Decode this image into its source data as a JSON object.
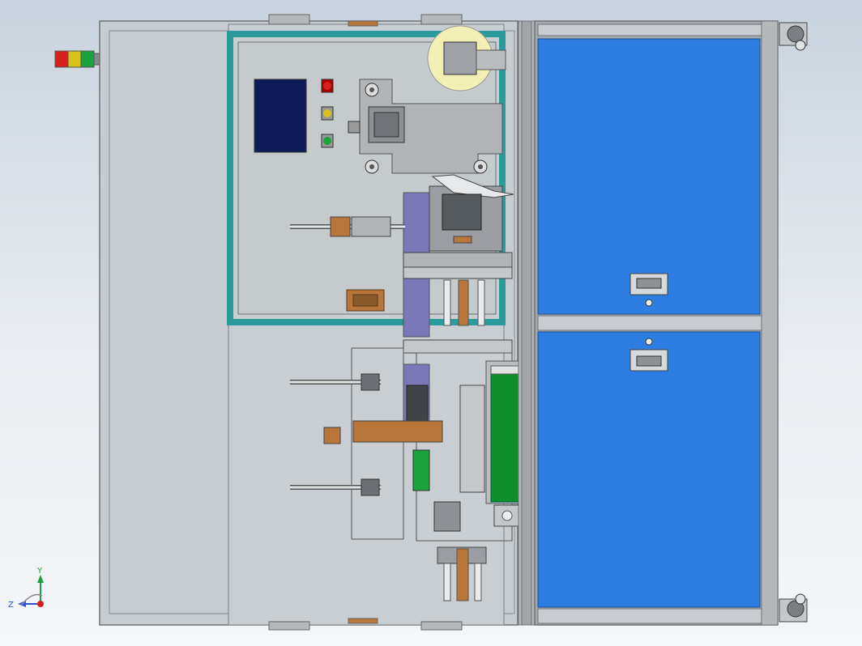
{
  "triad": {
    "y_label": "Y",
    "z_label": "Z"
  },
  "colors": {
    "frame": "#a7aaad",
    "frame_dark": "#6f7377",
    "blue_panel": "#2e7de2",
    "green_roller": "#0f8f2a",
    "teal_frame": "#2b9a9a",
    "screen": "#0d1b59",
    "purple_block": "#7a78b8",
    "copper": "#b8763a",
    "lamp_red": "#d62020",
    "lamp_yellow": "#d8c21a",
    "lamp_green": "#1aa33a"
  }
}
